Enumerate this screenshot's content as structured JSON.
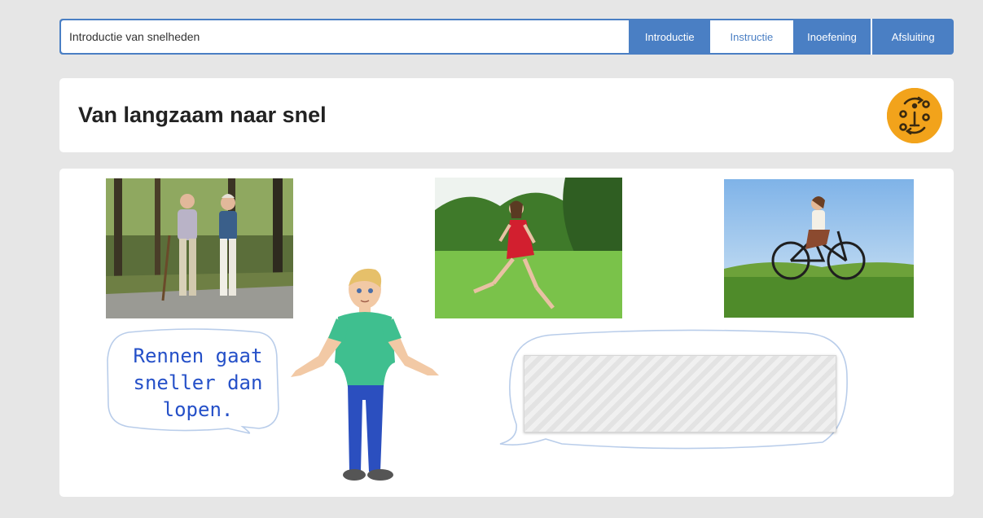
{
  "header": {
    "lesson_title": "Introductie van snelheden",
    "tabs": [
      {
        "label": "Introductie",
        "active": false
      },
      {
        "label": "Instructie",
        "active": true
      },
      {
        "label": "Inoefening",
        "active": false
      },
      {
        "label": "Afsluiting",
        "active": false
      }
    ]
  },
  "page": {
    "title": "Van langzaam naar snel",
    "info_icon": "info-badge-icon"
  },
  "content": {
    "photos": [
      "walking-couple",
      "running-girl",
      "cycling-woman"
    ],
    "speech_bubble_lines": [
      "Rennen gaat",
      "sneller dan",
      "lopen."
    ],
    "answer_box_state": "hidden"
  },
  "colors": {
    "background": "#e6e6e6",
    "accent": "#4a7fc4",
    "badge": "#f2a31b",
    "speech_text": "#2550c8",
    "bubble_outline": "#b9cdea"
  }
}
